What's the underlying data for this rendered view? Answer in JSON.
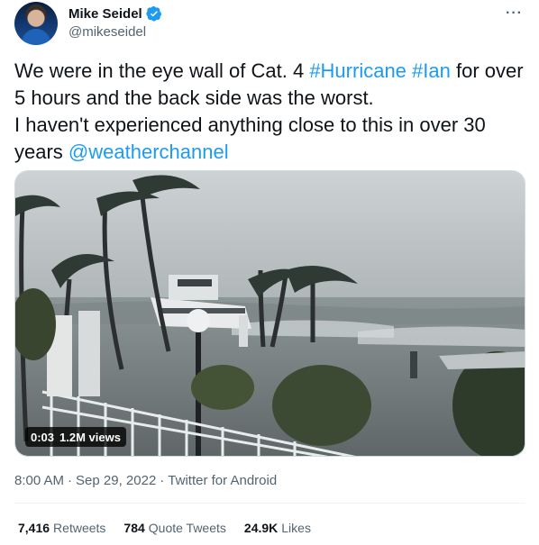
{
  "author": {
    "name": "Mike Seidel",
    "handle": "@mikeseidel",
    "avatar_icon": "profile-photo",
    "verified_icon": "verified-badge-icon"
  },
  "menu": {
    "more_label": "···"
  },
  "tweet": {
    "text_part1": "We were in the eye wall of Cat. 4 ",
    "hashtag1": "#Hurricane",
    "hashtag2": "#Ian",
    "text_part2": " for over 5 hours and the back side was the worst.",
    "text_line2": "I haven't experienced anything close to this in over 30 years ",
    "mention": "@weatherchannel"
  },
  "media": {
    "description_icon": "video-thumbnail",
    "duration": "0:03",
    "views": "1.2M views"
  },
  "meta": {
    "time": "8:00 AM",
    "sep1": "·",
    "date": "Sep 29, 2022",
    "sep2": "·",
    "source": "Twitter for Android"
  },
  "stats": {
    "retweets_count": "7,416",
    "retweets_label": "Retweets",
    "quotes_count": "784",
    "quotes_label": "Quote Tweets",
    "likes_count": "24.9K",
    "likes_label": "Likes"
  },
  "colors": {
    "link": "#1d9bf0",
    "verified": "#1d9bf0",
    "secondary_text": "#536471"
  }
}
